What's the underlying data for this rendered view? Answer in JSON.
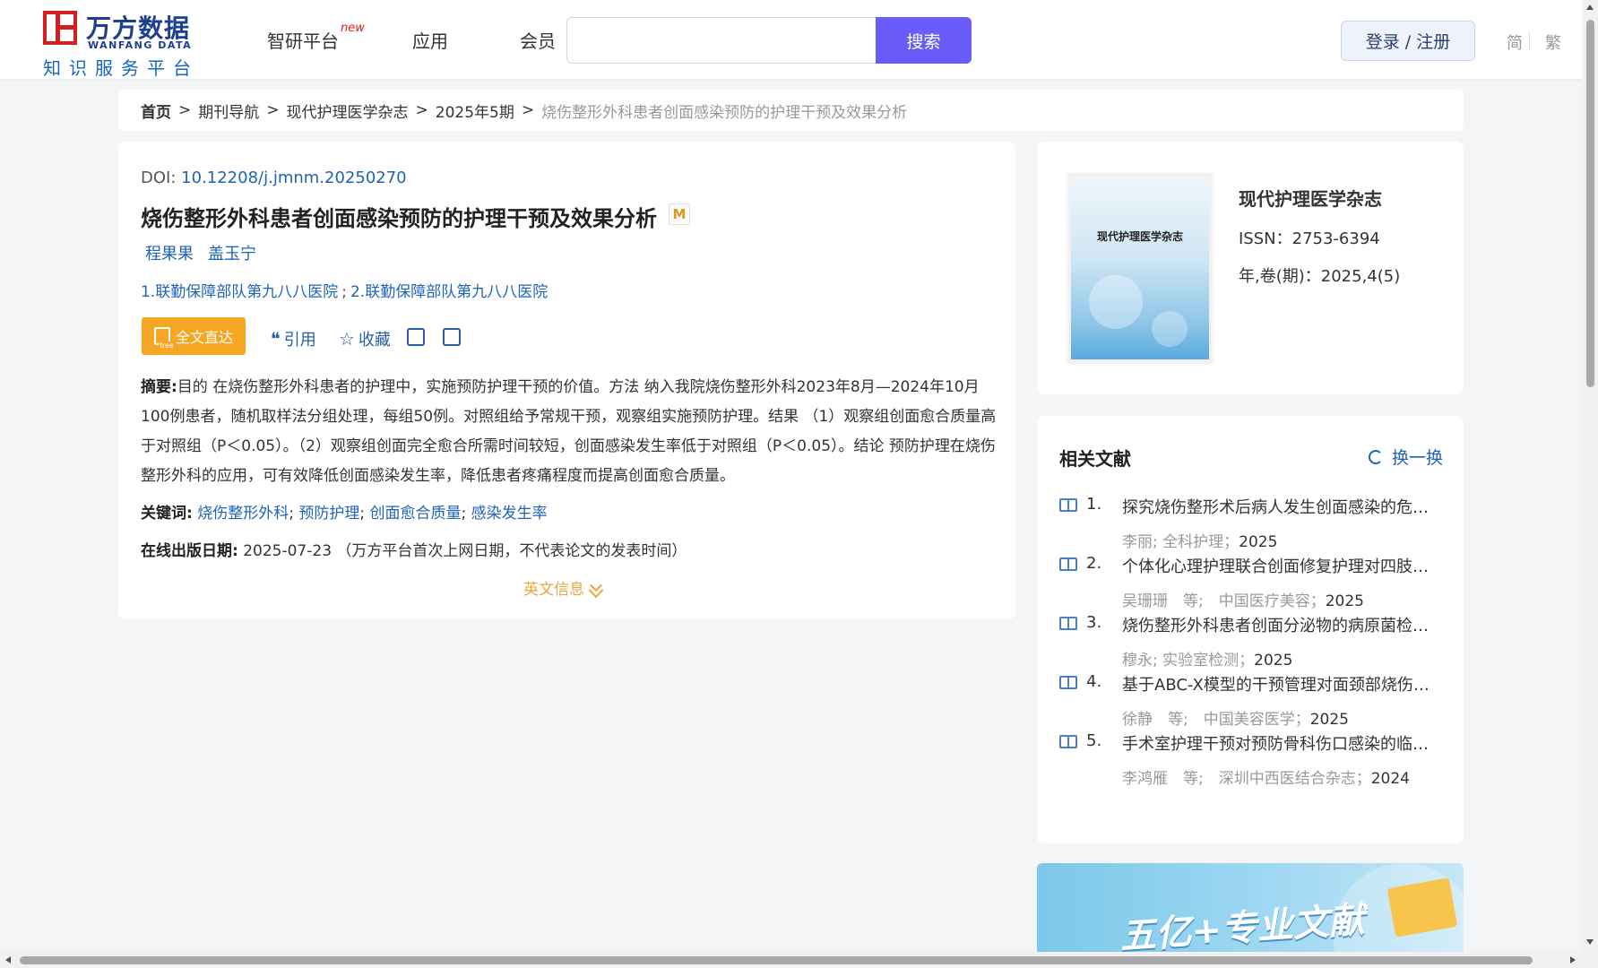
{
  "header": {
    "logo_cn": "万方数据",
    "logo_en": "WANFANG DATA",
    "logo_sub": "知识服务平台",
    "nav": [
      {
        "label": "智研平台",
        "badge": "new"
      },
      {
        "label": "应用"
      },
      {
        "label": "会员"
      }
    ],
    "search": {
      "placeholder": "",
      "button_label": "搜索"
    },
    "login_label": "登录 / 注册",
    "lang_simplified": "简",
    "lang_traditional": "繁"
  },
  "breadcrumb": {
    "items": [
      "首页",
      "期刊导航",
      "现代护理医学杂志",
      "2025年5期"
    ],
    "separator": ">",
    "current": "烧伤整形外科患者创面感染预防的护理干预及效果分析"
  },
  "article": {
    "doi_label": "DOI:",
    "doi_value": "10.12208/j.jmnm.20250270",
    "title": "烧伤整形外科患者创面感染预防的护理干预及效果分析",
    "m_badge": "M",
    "authors": [
      "程果果",
      "盖玉宁"
    ],
    "affiliations": [
      "1.联勤保障部队第九八八医院",
      "2.联勤保障部队第九八八医院"
    ],
    "affil_sep": ";",
    "fulltext_label": "全文直达",
    "cite_label": "引用",
    "collect_label": "收藏",
    "abstract_label": "摘要:",
    "abstract_text": "目的 在烧伤整形外科患者的护理中，实施预防护理干预的价值。方法 纳入我院烧伤整形外科2023年8月—2024年10月100例患者，随机取样法分组处理，每组50例。对照组给予常规干预，观察组实施预防护理。结果 （1）观察组创面愈合质量高于对照组（P＜0.05）。（2）观察组创面完全愈合所需时间较短，创面感染发生率低于对照组（P＜0.05）。结论 预防护理在烧伤整形外科的应用，可有效降低创面感染发生率，降低患者疼痛程度而提高创面愈合质量。",
    "keywords_label": "关键词:",
    "keywords": [
      "烧伤整形外科",
      "预防护理",
      "创面愈合质量",
      "感染发生率"
    ],
    "keyword_sep": ";",
    "pubdate_label": "在线出版日期:",
    "pubdate_value": "2025-07-23",
    "pubdate_note": "（万方平台首次上网日期，不代表论文的发表时间）",
    "en_info_label": "英文信息"
  },
  "journal": {
    "cover_title": "现代护理医学杂志",
    "name": "现代护理医学杂志",
    "issn": "ISSN：2753-6394",
    "volume": "年,卷(期)：2025,4(5)"
  },
  "related": {
    "title": "相关文献",
    "refresh_label": "换一换",
    "items": [
      {
        "num": "1.",
        "title": "探究烧伤整形术后病人发生创面感染的危险...",
        "authors": "李丽; 全科护理；",
        "year": "2025"
      },
      {
        "num": "2.",
        "title": "个体化心理护理联合创面修复护理对四肢烧...",
        "authors": "吴珊珊　等;　中国医疗美容；",
        "year": "2025"
      },
      {
        "num": "3.",
        "title": "烧伤整形外科患者创面分泌物的病原菌检测...",
        "authors": "穆永; 实验室检测；",
        "year": "2025"
      },
      {
        "num": "4.",
        "title": "基于ABC-X模型的干预管理对面颈部烧伤瘢...",
        "authors": "徐静　等;　中国美容医学；",
        "year": "2025"
      },
      {
        "num": "5.",
        "title": "手术室护理干预对预防骨科伤口感染的临床...",
        "authors": "李鸿雁　等;　深圳中西医结合杂志；",
        "year": "2024"
      }
    ]
  },
  "banner": {
    "text": "五亿+专业文献"
  }
}
